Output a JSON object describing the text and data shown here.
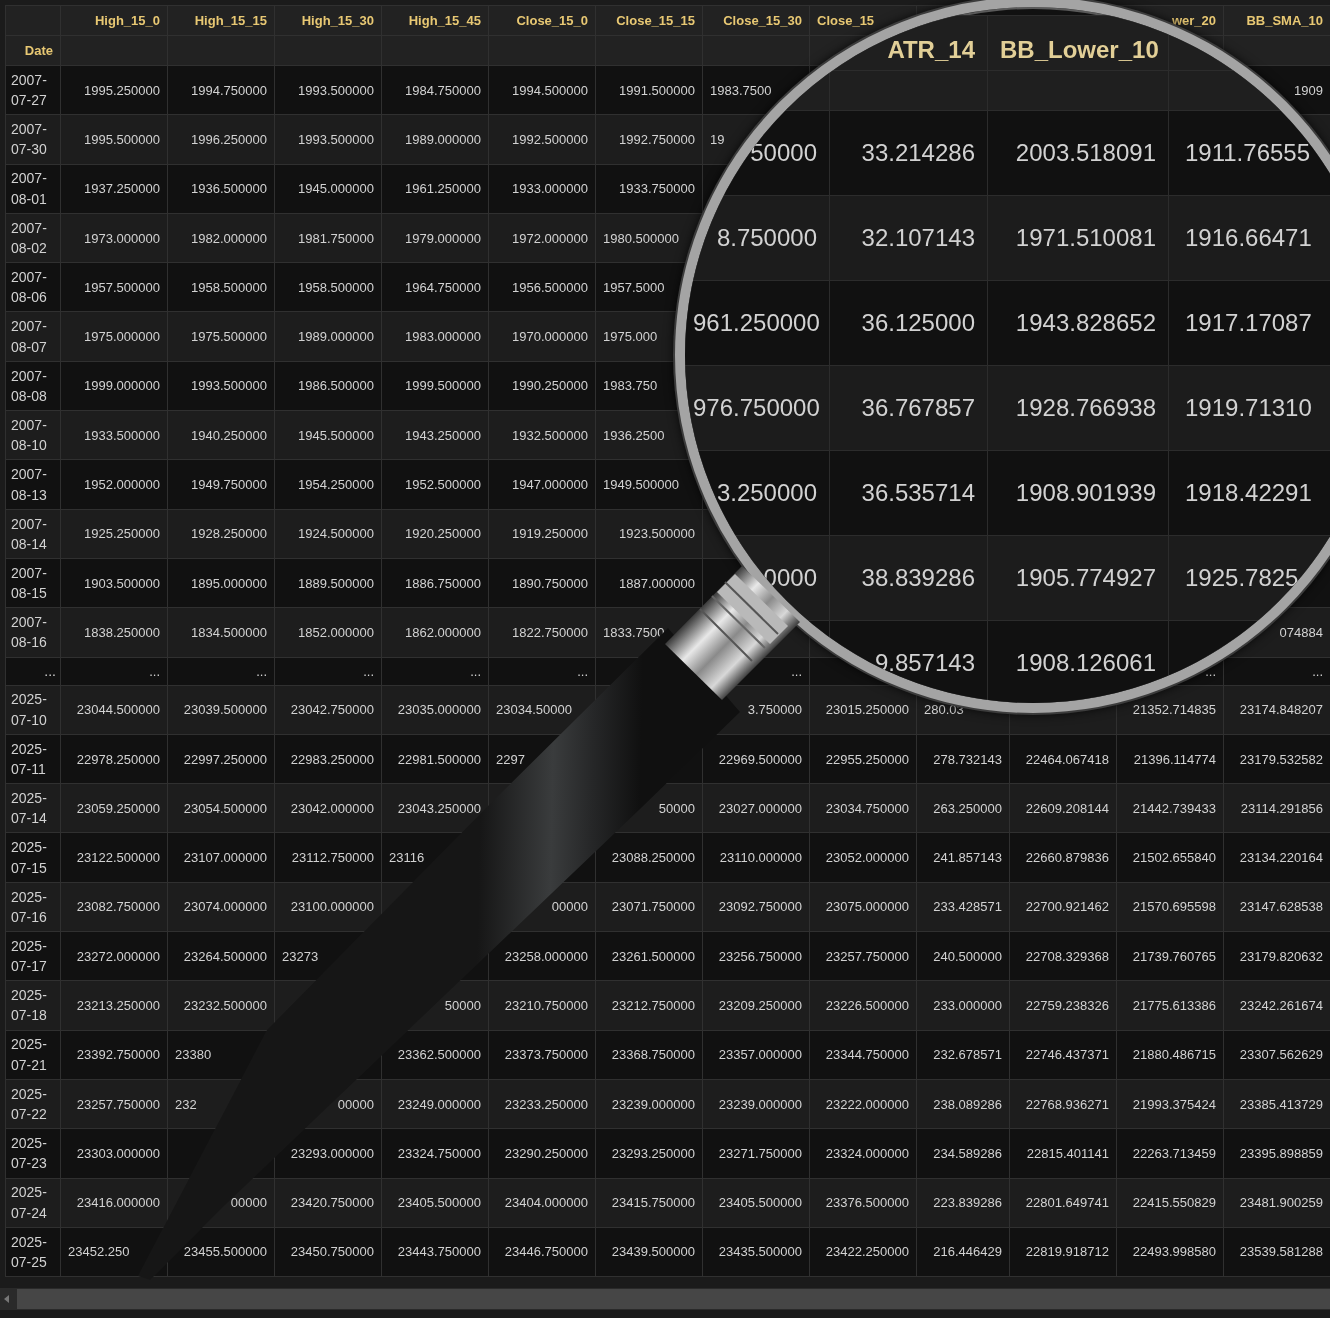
{
  "table": {
    "index_name": "Date",
    "columns": [
      "High_15_0",
      "High_15_15",
      "High_15_30",
      "High_15_45",
      "Close_15_0",
      "Close_15_15",
      "Close_15_30",
      "Close_15",
      null,
      null,
      "wer_20",
      "BB_SMA_10"
    ],
    "rows": [
      {
        "kind": "data",
        "date": "2007-07-27",
        "cells": [
          "1995.250000",
          "1994.750000",
          "1993.500000",
          "1984.750000",
          "1994.500000",
          "1991.500000",
          "1983.7500",
          null,
          null,
          null,
          null,
          "1909"
        ]
      },
      {
        "kind": "data",
        "date": "2007-07-30",
        "cells": [
          "1995.500000",
          "1996.250000",
          "1993.500000",
          "1989.000000",
          "1992.500000",
          "1992.750000",
          "19",
          null,
          null,
          null,
          null,
          null
        ]
      },
      {
        "kind": "data",
        "date": "2007-08-01",
        "cells": [
          "1937.250000",
          "1936.500000",
          "1945.000000",
          "1961.250000",
          "1933.000000",
          "1933.750000",
          null,
          null,
          null,
          null,
          null,
          null
        ]
      },
      {
        "kind": "data",
        "date": "2007-08-02",
        "cells": [
          "1973.000000",
          "1982.000000",
          "1981.750000",
          "1979.000000",
          "1972.000000",
          "1980.500000",
          null,
          null,
          null,
          null,
          null,
          null
        ]
      },
      {
        "kind": "data",
        "date": "2007-08-06",
        "cells": [
          "1957.500000",
          "1958.500000",
          "1958.500000",
          "1964.750000",
          "1956.500000",
          "1957.5000",
          null,
          null,
          null,
          null,
          null,
          null
        ]
      },
      {
        "kind": "data",
        "date": "2007-08-07",
        "cells": [
          "1975.000000",
          "1975.500000",
          "1989.000000",
          "1983.000000",
          "1970.000000",
          "1975.000",
          null,
          null,
          null,
          null,
          null,
          null
        ]
      },
      {
        "kind": "data",
        "date": "2007-08-08",
        "cells": [
          "1999.000000",
          "1993.500000",
          "1986.500000",
          "1999.500000",
          "1990.250000",
          "1983.750",
          null,
          null,
          null,
          null,
          null,
          null
        ]
      },
      {
        "kind": "data",
        "date": "2007-08-10",
        "cells": [
          "1933.500000",
          "1940.250000",
          "1945.500000",
          "1943.250000",
          "1932.500000",
          "1936.2500",
          null,
          null,
          null,
          null,
          null,
          null
        ]
      },
      {
        "kind": "data",
        "date": "2007-08-13",
        "cells": [
          "1952.000000",
          "1949.750000",
          "1954.250000",
          "1952.500000",
          "1947.000000",
          "1949.500000",
          null,
          null,
          null,
          null,
          null,
          null
        ]
      },
      {
        "kind": "data",
        "date": "2007-08-14",
        "cells": [
          "1925.250000",
          "1928.250000",
          "1924.500000",
          "1920.250000",
          "1919.250000",
          "1923.500000",
          null,
          null,
          null,
          null,
          null,
          null
        ]
      },
      {
        "kind": "data",
        "date": "2007-08-15",
        "cells": [
          "1903.500000",
          "1895.000000",
          "1889.500000",
          "1886.750000",
          "1890.750000",
          "1887.000000",
          null,
          null,
          null,
          null,
          null,
          null
        ]
      },
      {
        "kind": "data",
        "date": "2007-08-16",
        "cells": [
          "1838.250000",
          "1834.500000",
          "1852.000000",
          "1862.000000",
          "1822.750000",
          "1833.7500",
          null,
          null,
          null,
          null,
          null,
          "074884"
        ]
      },
      {
        "kind": "ellipsis",
        "date": "...",
        "cells": [
          "...",
          "...",
          "...",
          "...",
          "...",
          null,
          "...",
          null,
          null,
          null,
          "...",
          "..."
        ]
      },
      {
        "kind": "data",
        "date": "2025-07-10",
        "cells": [
          "23044.500000",
          "23039.500000",
          "23042.750000",
          "23035.000000",
          "23034.50000",
          null,
          "3.750000",
          "23015.250000",
          "280.03",
          null,
          "21352.714835",
          "23174.848207"
        ]
      },
      {
        "kind": "data",
        "date": "2025-07-11",
        "cells": [
          "22978.250000",
          "22997.250000",
          "22983.250000",
          "22981.500000",
          "2297",
          null,
          "22969.500000",
          "22955.250000",
          "278.732143",
          "22464.067418",
          "21396.114774",
          "23179.532582"
        ]
      },
      {
        "kind": "data",
        "date": "2025-07-14",
        "cells": [
          "23059.250000",
          "23054.500000",
          "23042.000000",
          "23043.250000",
          null,
          "50000",
          "23027.000000",
          "23034.750000",
          "263.250000",
          "22609.208144",
          "21442.739433",
          "23114.291856"
        ]
      },
      {
        "kind": "data",
        "date": "2025-07-15",
        "cells": [
          "23122.500000",
          "23107.000000",
          "23112.750000",
          "23116",
          null,
          "23088.250000",
          "23110.000000",
          "23052.000000",
          "241.857143",
          "22660.879836",
          "21502.655840",
          "23134.220164"
        ]
      },
      {
        "kind": "data",
        "date": "2025-07-16",
        "cells": [
          "23082.750000",
          "23074.000000",
          "23100.000000",
          null,
          "00000",
          "23071.750000",
          "23092.750000",
          "23075.000000",
          "233.428571",
          "22700.921462",
          "21570.695598",
          "23147.628538"
        ]
      },
      {
        "kind": "data",
        "date": "2025-07-17",
        "cells": [
          "23272.000000",
          "23264.500000",
          "23273",
          null,
          "23258.000000",
          "23261.500000",
          "23256.750000",
          "23257.750000",
          "240.500000",
          "22708.329368",
          "21739.760765",
          "23179.820632"
        ]
      },
      {
        "kind": "data",
        "date": "2025-07-18",
        "cells": [
          "23213.250000",
          "23232.500000",
          null,
          "50000",
          "23210.750000",
          "23212.750000",
          "23209.250000",
          "23226.500000",
          "233.000000",
          "22759.238326",
          "21775.613386",
          "23242.261674"
        ]
      },
      {
        "kind": "data",
        "date": "2025-07-21",
        "cells": [
          "23392.750000",
          "23380",
          null,
          "23362.500000",
          "23373.750000",
          "23368.750000",
          "23357.000000",
          "23344.750000",
          "232.678571",
          "22746.437371",
          "21880.486715",
          "23307.562629"
        ]
      },
      {
        "kind": "data",
        "date": "2025-07-22",
        "cells": [
          "23257.750000",
          "232",
          "00000",
          "23249.000000",
          "23233.250000",
          "23239.000000",
          "23239.000000",
          "23222.000000",
          "238.089286",
          "22768.936271",
          "21993.375424",
          "23385.413729"
        ]
      },
      {
        "kind": "data",
        "date": "2025-07-23",
        "cells": [
          "23303.000000",
          null,
          "23293.000000",
          "23324.750000",
          "23290.250000",
          "23293.250000",
          "23271.750000",
          "23324.000000",
          "234.589286",
          "22815.401141",
          "22263.713459",
          "23395.898859"
        ]
      },
      {
        "kind": "data",
        "date": "2025-07-24",
        "cells": [
          "23416.000000",
          "00000",
          "23420.750000",
          "23405.500000",
          "23404.000000",
          "23415.750000",
          "23405.500000",
          "23376.500000",
          "223.839286",
          "22801.649741",
          "22415.550829",
          "23481.900259"
        ]
      },
      {
        "kind": "data",
        "date": "2025-07-25",
        "cells": [
          "23452.250",
          "23455.500000",
          "23450.750000",
          "23443.750000",
          "23446.750000",
          "23439.500000",
          "23435.500000",
          "23422.250000",
          "216.446429",
          "22819.918712",
          "22493.998580",
          "23539.581288"
        ]
      }
    ]
  },
  "magnifier": {
    "columns": [
      null,
      "ATR_14",
      "BB_Lower_10",
      null
    ],
    "rows": [
      [
        "50000",
        "33.214286",
        "2003.518091",
        "1911.76555"
      ],
      [
        "8.750000",
        "32.107143",
        "1971.510081",
        "1916.66471"
      ],
      [
        "961.250000",
        "36.125000",
        "1943.828652",
        "1917.17087"
      ],
      [
        "976.750000",
        "36.767857",
        "1928.766938",
        "1919.71310"
      ],
      [
        "3.250000",
        "36.535714",
        "1908.901939",
        "1918.42291"
      ],
      [
        "0000",
        "38.839286",
        "1905.774927",
        "1925.7825"
      ],
      [
        null,
        "9.857143",
        "1908.126061",
        null
      ]
    ]
  }
}
